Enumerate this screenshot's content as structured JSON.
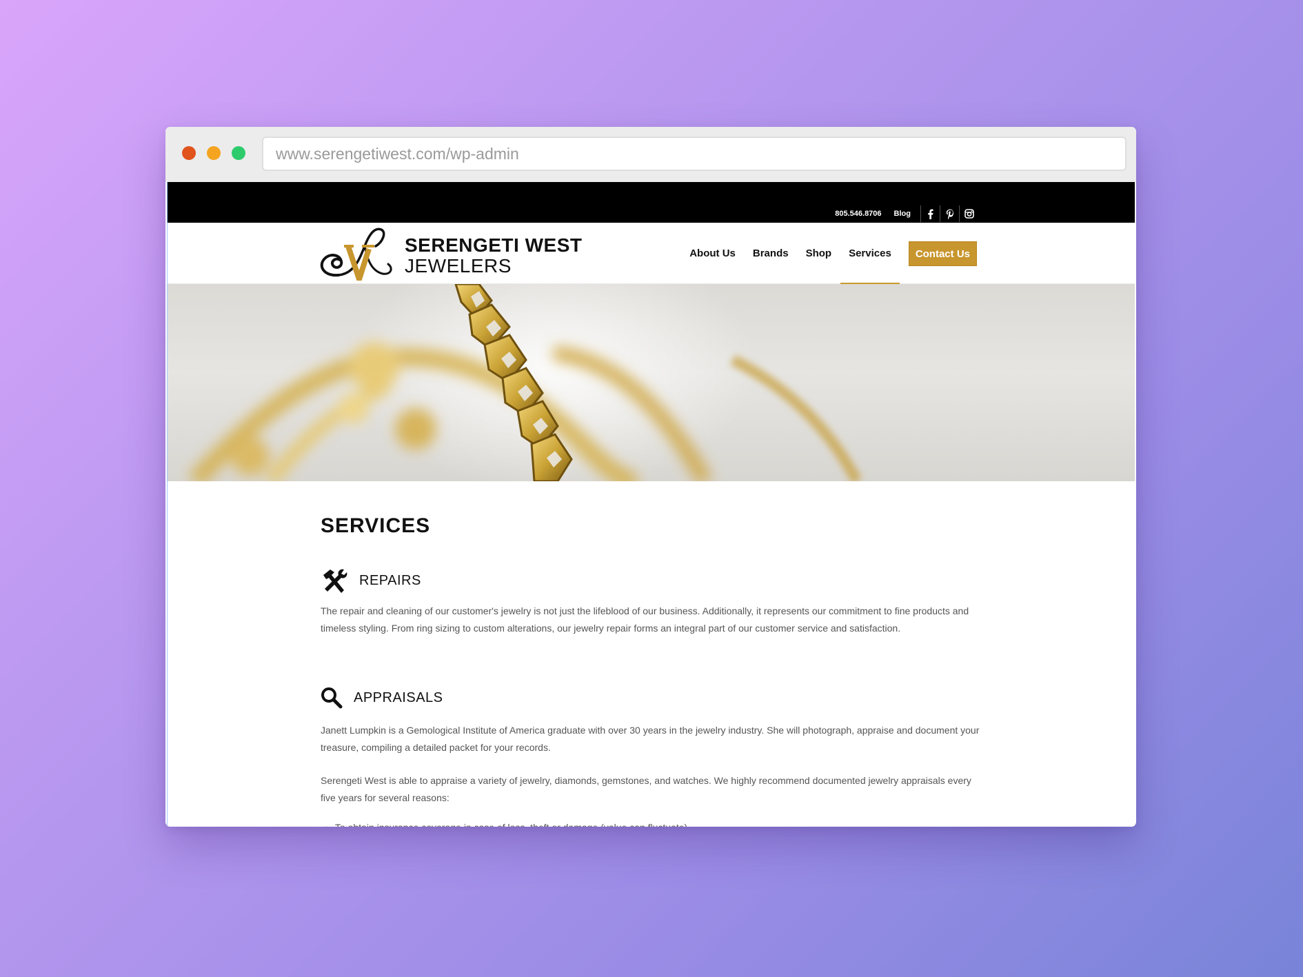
{
  "browser": {
    "url": "www.serengetiwest.com/wp-admin"
  },
  "topbar": {
    "phone": "805.546.8706",
    "blog": "Blog",
    "social_icons": [
      "facebook-icon",
      "pinterest-icon",
      "instagram-icon"
    ]
  },
  "brand": {
    "line1": "SERENGETI WEST",
    "line2": "JEWELERS",
    "accent_color": "#c8962e"
  },
  "nav": {
    "items": [
      {
        "label": "About Us"
      },
      {
        "label": "Brands"
      },
      {
        "label": "Shop"
      },
      {
        "label": "Services",
        "active": true
      }
    ],
    "contact_label": "Contact Us"
  },
  "main": {
    "title": "SERVICES",
    "repairs": {
      "title": "REPAIRS",
      "icon": "hammer-wrench-icon",
      "text": "The repair and cleaning of our customer's jewelry is not just the lifeblood of our business. Additionally, it represents our commitment to fine products and timeless styling. From ring sizing to custom alterations, our jewelry repair forms an integral part of our customer service and satisfaction."
    },
    "appraisals": {
      "title": "APPRAISALS",
      "icon": "magnifier-icon",
      "text1": "Janett Lumpkin is a Gemological Institute of America graduate with over 30 years in the jewelry industry. She will photograph, appraise and document your treasure, compiling a detailed packet for your records.",
      "text2": "Serengeti West is able to appraise a variety of jewelry, diamonds, gemstones, and watches. We highly recommend documented jewelry appraisals every five years for several reasons:",
      "bullets": [
        "To obtain insurance coverage in case of loss, theft or damage (value can fluctuate)"
      ]
    }
  }
}
